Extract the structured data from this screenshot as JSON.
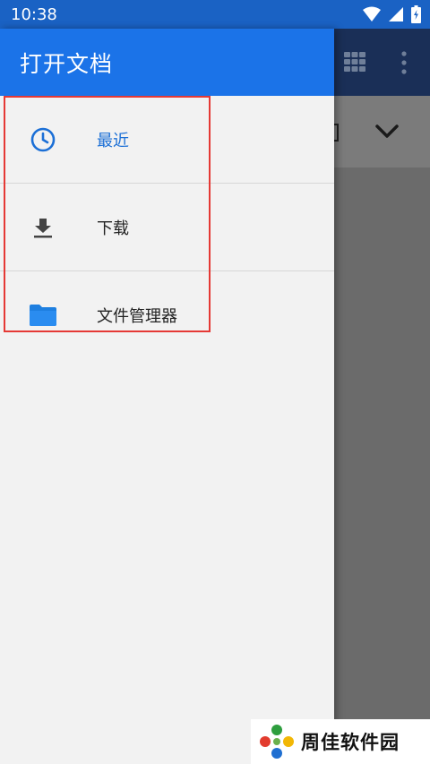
{
  "status_bar": {
    "time": "10:38",
    "icons": [
      "wifi-icon",
      "signal-icon",
      "battery-icon"
    ]
  },
  "drawer": {
    "title": "打开文档",
    "items": [
      {
        "label": "最近",
        "icon": "clock-icon",
        "active": true
      },
      {
        "label": "下载",
        "icon": "download-icon",
        "active": false
      },
      {
        "label": "文件管理器",
        "icon": "folder-icon",
        "active": false
      }
    ]
  },
  "background": {
    "icons": [
      "grid-view-icon",
      "more-vert-icon",
      "chevron-down-icon"
    ]
  },
  "watermark": {
    "text": "周佳软件园"
  },
  "colors": {
    "status_bar": "#1a62c4",
    "header": "#1b73e8",
    "drawer_bg": "#f2f2f2",
    "active_text": "#1b6fd6",
    "highlight": "#e53935",
    "scrim": "#6b6b6b"
  }
}
